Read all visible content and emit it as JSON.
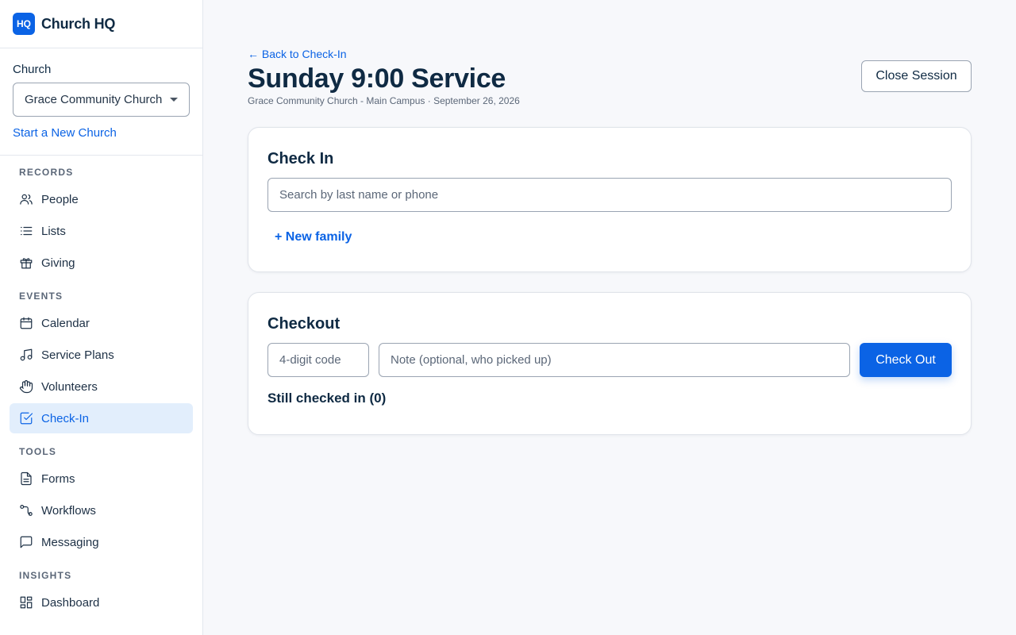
{
  "brand": {
    "logo_text": "HQ",
    "name": "Church HQ"
  },
  "church": {
    "label": "Church",
    "selected": "Grace Community Church - Main Campus",
    "new_church_link": "Start a New Church"
  },
  "nav": {
    "sections": [
      {
        "title": "RECORDS",
        "items": [
          {
            "label": "People",
            "icon": "people-icon"
          },
          {
            "label": "Lists",
            "icon": "list-icon"
          },
          {
            "label": "Giving",
            "icon": "gift-icon"
          }
        ]
      },
      {
        "title": "EVENTS",
        "items": [
          {
            "label": "Calendar",
            "icon": "calendar-icon"
          },
          {
            "label": "Service Plans",
            "icon": "music-icon"
          },
          {
            "label": "Volunteers",
            "icon": "hand-icon"
          },
          {
            "label": "Check-In",
            "icon": "check-square-icon",
            "active": true
          }
        ]
      },
      {
        "title": "TOOLS",
        "items": [
          {
            "label": "Forms",
            "icon": "document-icon"
          },
          {
            "label": "Workflows",
            "icon": "workflow-icon"
          },
          {
            "label": "Messaging",
            "icon": "message-icon"
          }
        ]
      },
      {
        "title": "INSIGHTS",
        "items": [
          {
            "label": "Dashboard",
            "icon": "dashboard-icon"
          }
        ]
      }
    ]
  },
  "header": {
    "back_link": "← Back to Check-In",
    "title": "Sunday 9:00 Service",
    "subtitle": "Grace Community Church - Main Campus · September 26, 2026",
    "close_button": "Close Session"
  },
  "checkin": {
    "title": "Check In",
    "search_placeholder": "Search by last name or phone",
    "new_family": "+ New family"
  },
  "checkout": {
    "title": "Checkout",
    "code_placeholder": "4-digit code",
    "note_placeholder": "Note (optional, who picked up)",
    "button": "Check Out",
    "still_checked_in": "Still checked in (0)"
  },
  "colors": {
    "accent": "#0b63e5",
    "active_bg": "#e2eefc",
    "text": "#0f2a43"
  }
}
